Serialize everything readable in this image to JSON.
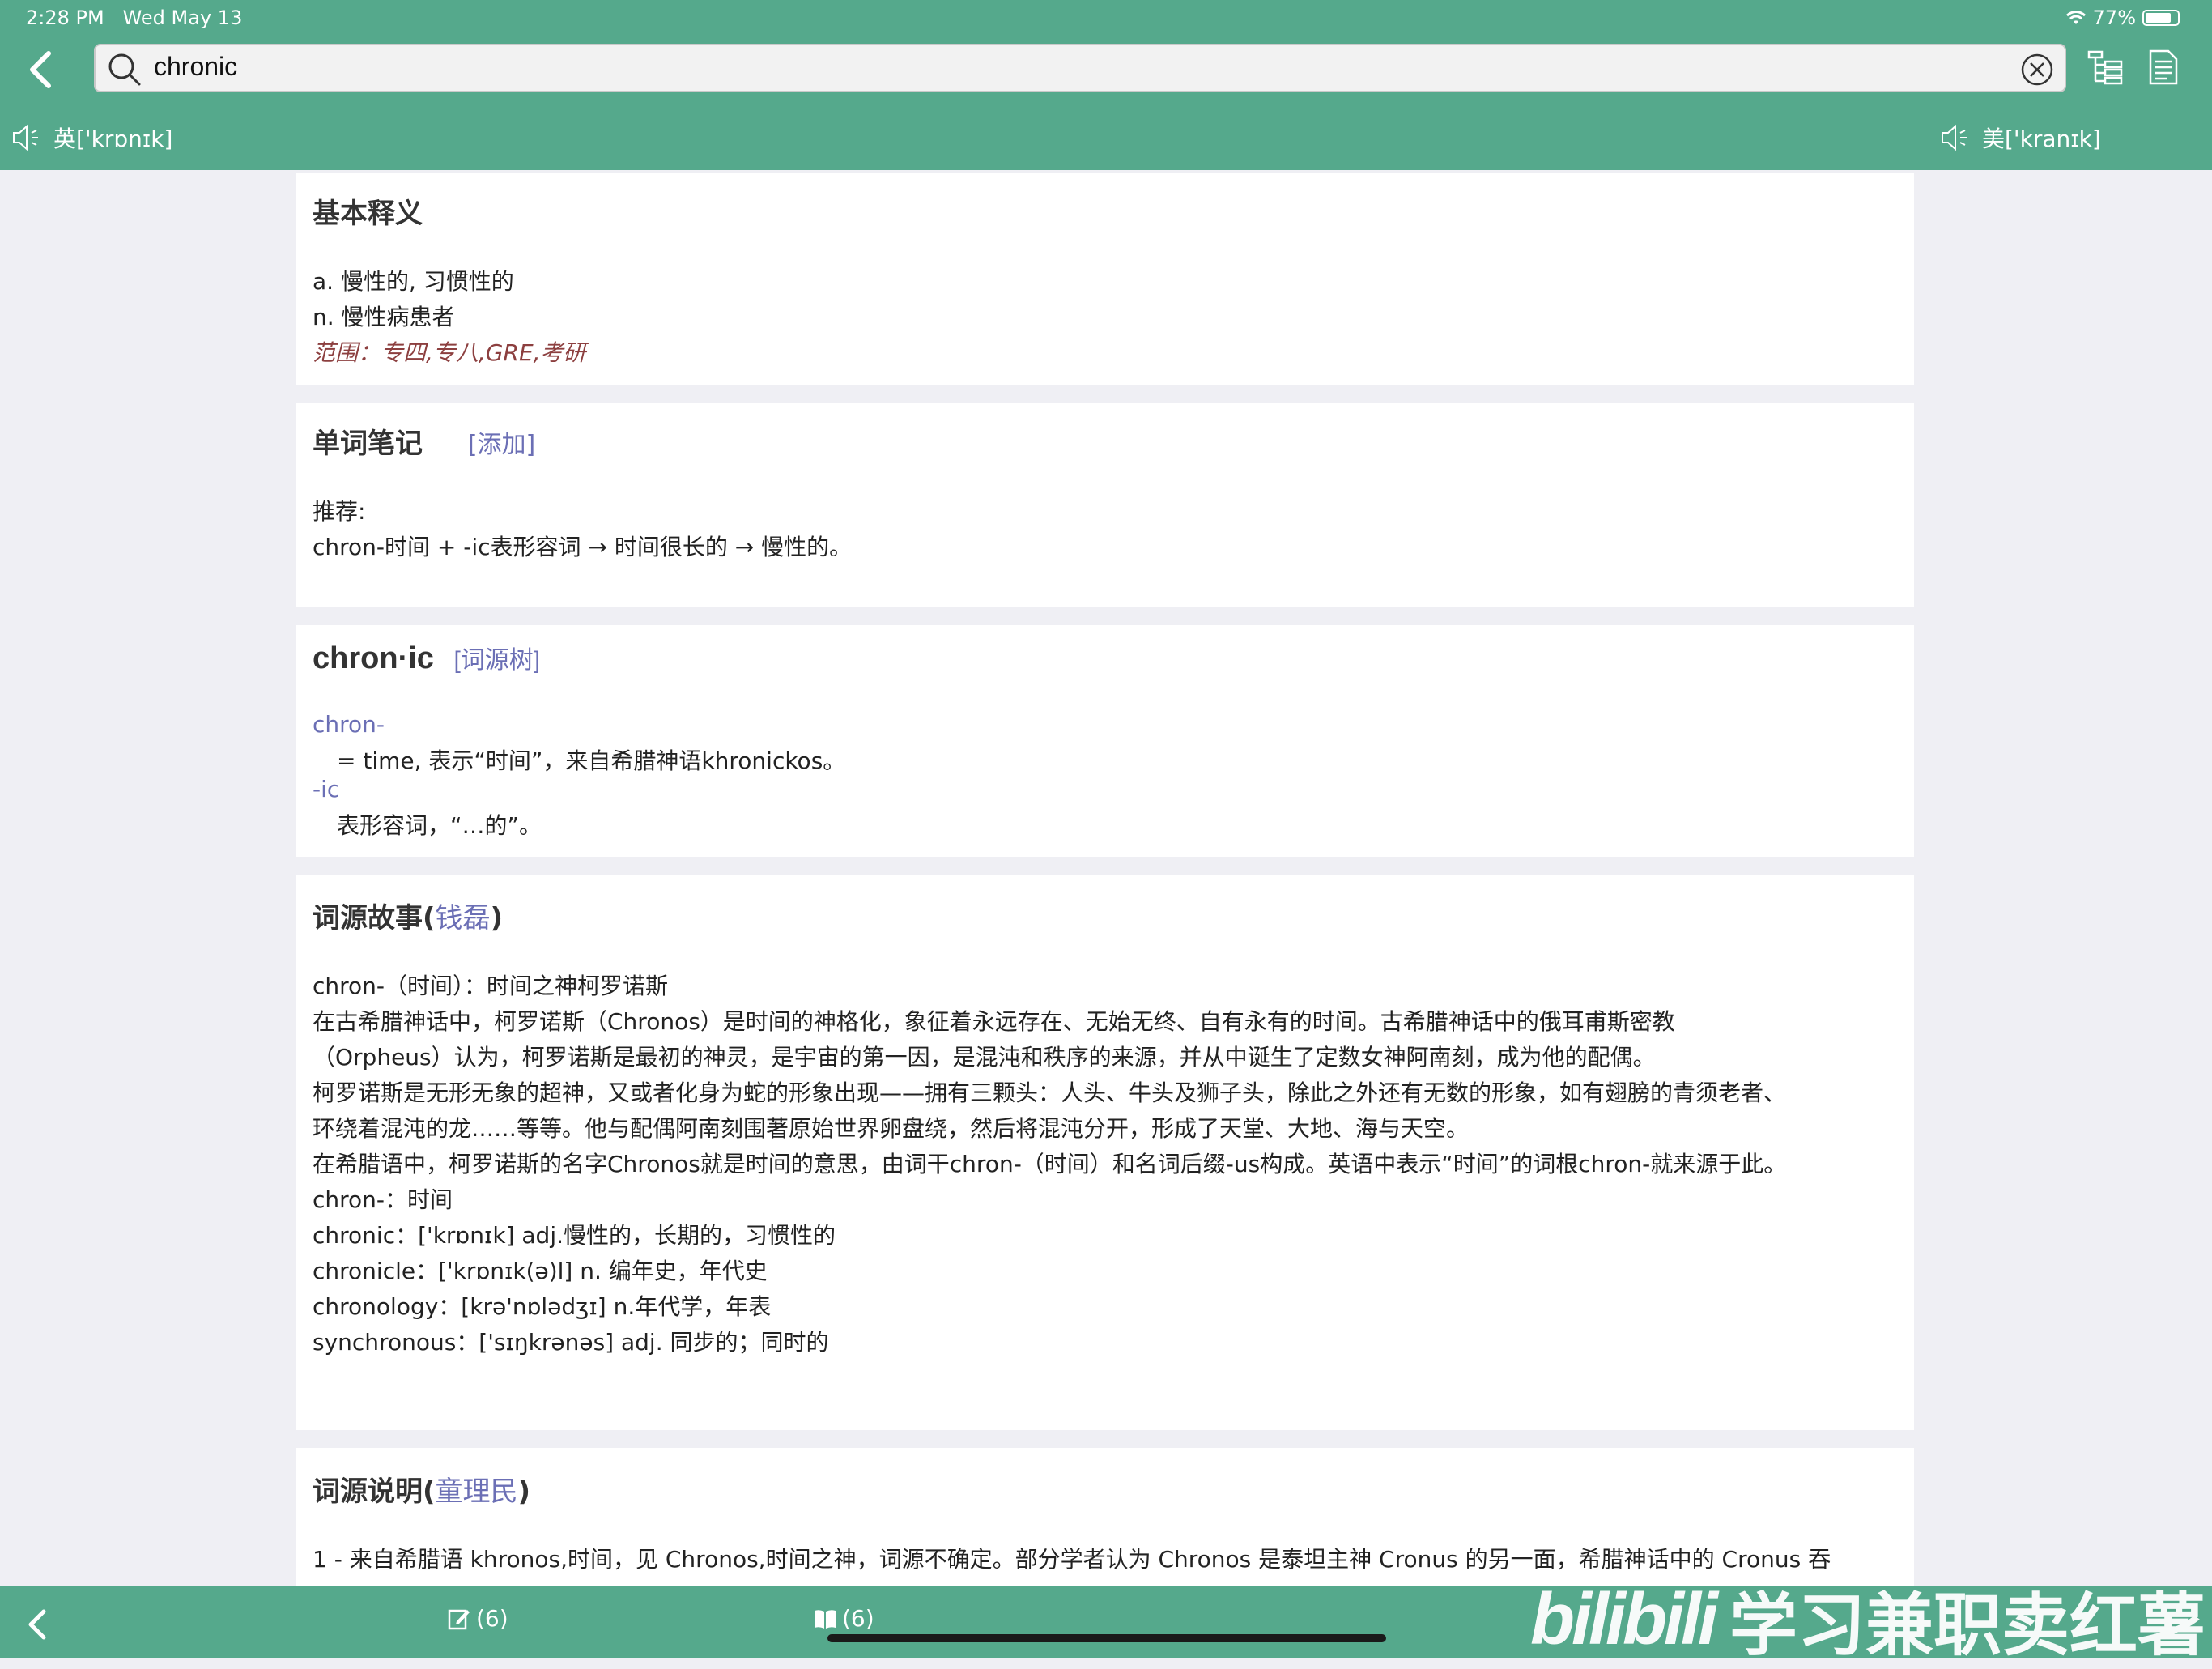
{
  "status": {
    "time": "2:28 PM",
    "date": "Wed May 13",
    "battery": "77%"
  },
  "search": {
    "query": "chronic"
  },
  "pronunciation": {
    "uk": "英['krɒnɪk]",
    "us": "美['kranɪk]"
  },
  "basic": {
    "title": "基本释义",
    "lines": [
      "a. 慢性的, 习惯性的",
      "n. 慢性病患者"
    ],
    "range": "范围：专四,专八,GRE,考研"
  },
  "notes": {
    "title": "单词笔记",
    "add": "[添加]",
    "recommend_label": "推荐:",
    "text": "chron-时间 + -ic表形容词 → 时间很长的 → 慢性的。"
  },
  "etymology": {
    "word": "chron·ic",
    "tree_link": "[词源树]",
    "part1": "chron-",
    "part1_desc": "= time, 表示“时间”，来自希腊神语khronickos。",
    "part2": "-ic",
    "part2_desc": "表形容词，“…的”。"
  },
  "story": {
    "title_prefix": "词源故事(",
    "author": "钱磊",
    "title_suffix": ")",
    "lines": [
      "chron-（时间）：时间之神柯罗诺斯",
      "在古希腊神话中，柯罗诺斯（Chronos）是时间的神格化，象征着永远存在、无始无终、自有永有的时间。古希腊神话中的俄耳甫斯密教",
      "（Orpheus）认为，柯罗诺斯是最初的神灵，是宇宙的第一因，是混沌和秩序的来源，并从中诞生了定数女神阿南刻，成为他的配偶。",
      "柯罗诺斯是无形无象的超神，又或者化身为蛇的形象出现——拥有三颗头：人头、牛头及狮子头，除此之外还有无数的形象，如有翅膀的青须老者、",
      "环绕着混沌的龙……等等。他与配偶阿南刻围著原始世界卵盘绕，然后将混沌分开，形成了天堂、大地、海与天空。",
      "在希腊语中，柯罗诺斯的名字Chronos就是时间的意思，由词干chron-（时间）和名词后缀-us构成。英语中表示“时间”的词根chron-就来源于此。",
      "chron-：时间",
      "chronic：['krɒnɪk] adj.慢性的，长期的，习惯性的",
      "chronicle：['krɒnɪk(ə)l] n. 编年史，年代史",
      "chronology：[krə'nɒlədʒɪ] n.年代学，年表",
      "synchronous：['sɪŋkrənəs] adj. 同步的；同时的"
    ]
  },
  "explanation": {
    "title_prefix": "词源说明(",
    "author": "童理民",
    "title_suffix": ")",
    "line1": "1 - 来自希腊语 khronos,时间，见 Chronos,时间之神，词源不确定。部分学者认为 Chronos 是泰坦主神 Cronus 的另一面，希腊神话中的 Cronus 吞"
  },
  "bottom": {
    "notes_count": "(6)",
    "book_count": "(6)"
  },
  "watermark": {
    "logo": "bilibili",
    "text": "学习兼职卖红薯"
  },
  "colors": {
    "header": "#55a98c",
    "link": "#6b6fb5",
    "range": "#8c3f3f"
  }
}
